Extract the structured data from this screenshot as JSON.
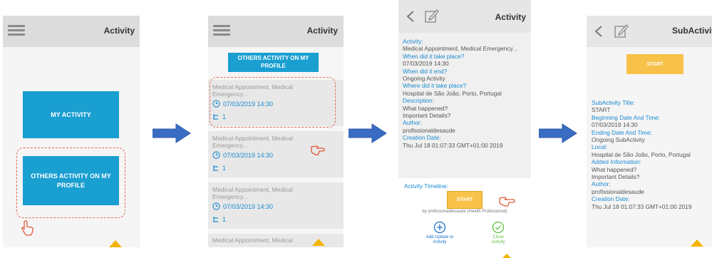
{
  "colors": {
    "accent": "#1a9fd1",
    "link": "#1a8ad0",
    "arrow": "#3b6cc4",
    "start": "#f8c24a",
    "green": "#5fbf3d",
    "dashed": "#e26a5a"
  },
  "screen1": {
    "title": "Activity",
    "my_activity_label": "MY ACTIVITY",
    "others_activity_label": "OTHERS ACTIVITY ON MY PROFILE",
    "menu_icon": "hamburger-menu-icon",
    "hand_icon": "pointing-hand-icon"
  },
  "screen2": {
    "title": "Activity",
    "header_button_label": "OTHERS ACTIVITY ON MY PROFILE",
    "items": [
      {
        "title": "Medical Appointment, Medical Emergency...",
        "datetime": "07/03/2019 14:30",
        "count": "1"
      },
      {
        "title": "Medical Appointment, Medical Emergency...",
        "datetime": "07/03/2019 14:30",
        "count": "1"
      },
      {
        "title": "Medical Appointment, Medical Emergency...",
        "datetime": "07/03/2019 14:30",
        "count": "1"
      },
      {
        "title": "Medical Appointment, Medical"
      }
    ]
  },
  "screen3": {
    "title": "Activity",
    "fields": [
      {
        "label": "Activity:",
        "value": "Medical Appointment, Medical Emergency..."
      },
      {
        "label": "When did it take place?",
        "value": "07/03/2019 14:30"
      },
      {
        "label": "When did it end?",
        "value": "Ongoing Activity"
      },
      {
        "label": "Where did it take place?",
        "value": "Hospital de São João, Porto, Portugal"
      },
      {
        "label": "Description:",
        "value": "What happened?\nImportant Details?"
      },
      {
        "label": "Author:",
        "value": "profissionaldesaude"
      },
      {
        "label": "Creation Date:",
        "value": "Thu Jul 18 01:07:33 GMT+01:00 2019"
      }
    ],
    "timeline_label": "Activity Timeline:",
    "start_label": "START",
    "timeline_by": "by profissionaldesaude (Health Professional)",
    "add_update_label": "Add Update to\nActivity",
    "close_label": "Close\nActivity"
  },
  "screen4": {
    "title": "SubActivity",
    "start_label": "START",
    "fields": [
      {
        "label": "SubActivity Title:",
        "value": "START"
      },
      {
        "label": "Beginning Date And Time:",
        "value": "07/03/2019 14:30"
      },
      {
        "label": "Ending Date And Time:",
        "value": "Ongoing SubActivity"
      },
      {
        "label": "Local:",
        "value": "Hospital de São João, Porto, Portugal"
      },
      {
        "label": "Added Information:",
        "value": "What happened?\nImportant Details?"
      },
      {
        "label": "Author:",
        "value": "profissionaldesaude"
      },
      {
        "label": "Creation Date:",
        "value": "Thu Jul 18 01:07:33 GMT+01:00 2019"
      }
    ]
  }
}
